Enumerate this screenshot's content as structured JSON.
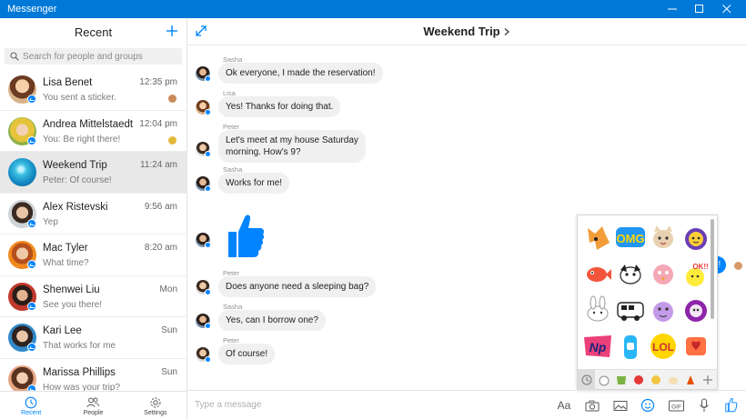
{
  "window": {
    "title": "Messenger"
  },
  "left": {
    "title": "Recent",
    "search_placeholder": "Search for people and groups",
    "conversations": [
      {
        "name": "Lisa Benet",
        "time": "12:35 pm",
        "snippet": "You sent a sticker."
      },
      {
        "name": "Andrea Mittelstaedt",
        "time": "12:04 pm",
        "snippet": "You: Be right there!"
      },
      {
        "name": "Weekend Trip",
        "time": "11:24 am",
        "snippet": "Peter: Of course!"
      },
      {
        "name": "Alex Ristevski",
        "time": "9:56 am",
        "snippet": "Yep"
      },
      {
        "name": "Mac Tyler",
        "time": "8:20 am",
        "snippet": "What time?"
      },
      {
        "name": "Shenwei Liu",
        "time": "Mon",
        "snippet": "See you there!"
      },
      {
        "name": "Kari Lee",
        "time": "Sun",
        "snippet": "That works for me"
      },
      {
        "name": "Marissa Phillips",
        "time": "Sun",
        "snippet": "How was your trip?"
      }
    ],
    "nav": [
      {
        "label": "Recent"
      },
      {
        "label": "People"
      },
      {
        "label": "Settings"
      }
    ]
  },
  "chat": {
    "title": "Weekend Trip",
    "messages": [
      {
        "sender": "Sasha",
        "text": "Ok everyone, I made the reservation!"
      },
      {
        "sender": "Lisa",
        "text": "Yes! Thanks for doing that."
      },
      {
        "sender": "Peter",
        "text_line1": "Let's meet at my house Saturday",
        "text_line2": "morning. How's 9?"
      },
      {
        "sender": "Sasha",
        "text": "Works for me!"
      },
      {
        "sender": "Peter",
        "text": "Does anyone need a sleeping bag?"
      },
      {
        "sender": "Sasha",
        "text": "Yes, can I borrow one?"
      },
      {
        "sender": "Peter",
        "text": "Of course!"
      }
    ],
    "peek_bubble": "o!",
    "composer_placeholder": "Type a message",
    "aa_label": "Aa",
    "gif_label": "GIF"
  },
  "stickers": {
    "omg": "OMG",
    "np": "Np",
    "lol": "LOL",
    "ok": "OK!!"
  },
  "colors": {
    "accent": "#0084ff",
    "titlebar": "#0078d7",
    "bubble_gray": "#f1f0f0"
  }
}
